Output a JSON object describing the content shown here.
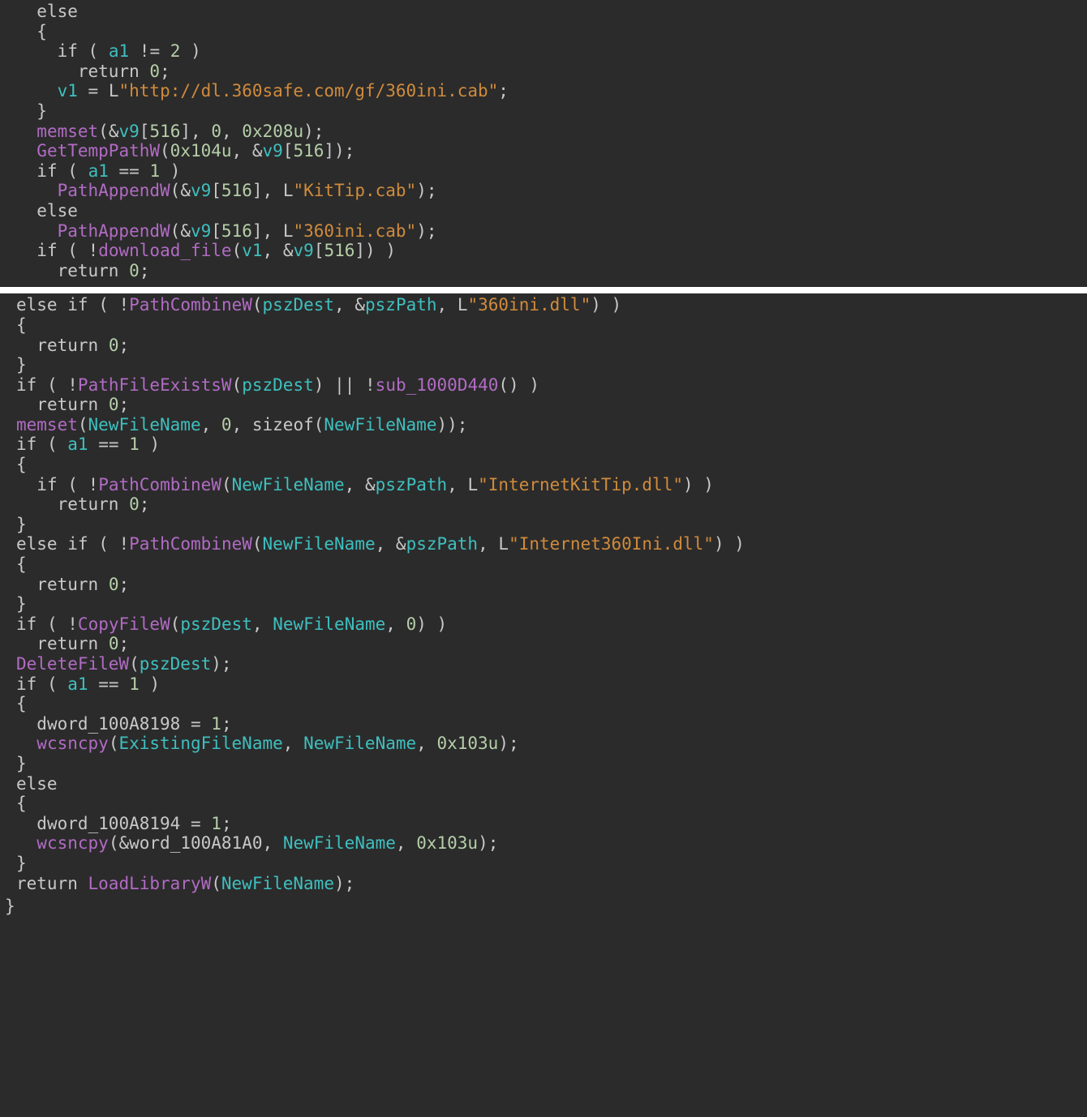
{
  "block1": {
    "kw_else": "else",
    "kw_if": "if",
    "kw_return": "return",
    "var_a1": "a1",
    "num_2": "2",
    "num_0": "0",
    "var_v1": "v1",
    "str_url": "\"http://dl.360safe.com/gf/360ini.cab\"",
    "fn_memset": "memset",
    "var_v9": "v9",
    "idx_516": "516",
    "hex_208u": "0x208u",
    "fn_GetTempPathW": "GetTempPathW",
    "hex_104u": "0x104u",
    "num_1": "1",
    "fn_PathAppendW": "PathAppendW",
    "str_KitTip": "\"KitTip.cab\"",
    "str_360ini": "\"360ini.cab\"",
    "fn_download_file": "download_file",
    "pfx_L": "L"
  },
  "block2": {
    "kw_else": "else",
    "kw_if": "if",
    "kw_return": "return",
    "fn_PathCombineW": "PathCombineW",
    "var_pszDest": "pszDest",
    "var_pszPath": "pszPath",
    "str_360iniDll": "\"360ini.dll\"",
    "num_0": "0",
    "fn_PathFileExistsW": "PathFileExistsW",
    "fn_sub1000D440": "sub_1000D440",
    "fn_memset": "memset",
    "var_NewFileName": "NewFileName",
    "kw_sizeof": "sizeof",
    "var_a1": "a1",
    "num_1": "1",
    "str_InternetKitTip": "\"InternetKitTip.dll\"",
    "str_Internet360Ini": "\"Internet360Ini.dll\"",
    "fn_CopyFileW": "CopyFileW",
    "fn_DeleteFileW": "DeleteFileW",
    "gl_dword198": "dword_100A8198",
    "fn_wcsncpy": "wcsncpy",
    "var_ExistingFileName": "ExistingFileName",
    "hex_103u": "0x103u",
    "gl_dword194": "dword_100A8194",
    "gl_word100A81A0": "word_100A81A0",
    "fn_LoadLibraryW": "LoadLibraryW",
    "pfx_L": "L"
  }
}
